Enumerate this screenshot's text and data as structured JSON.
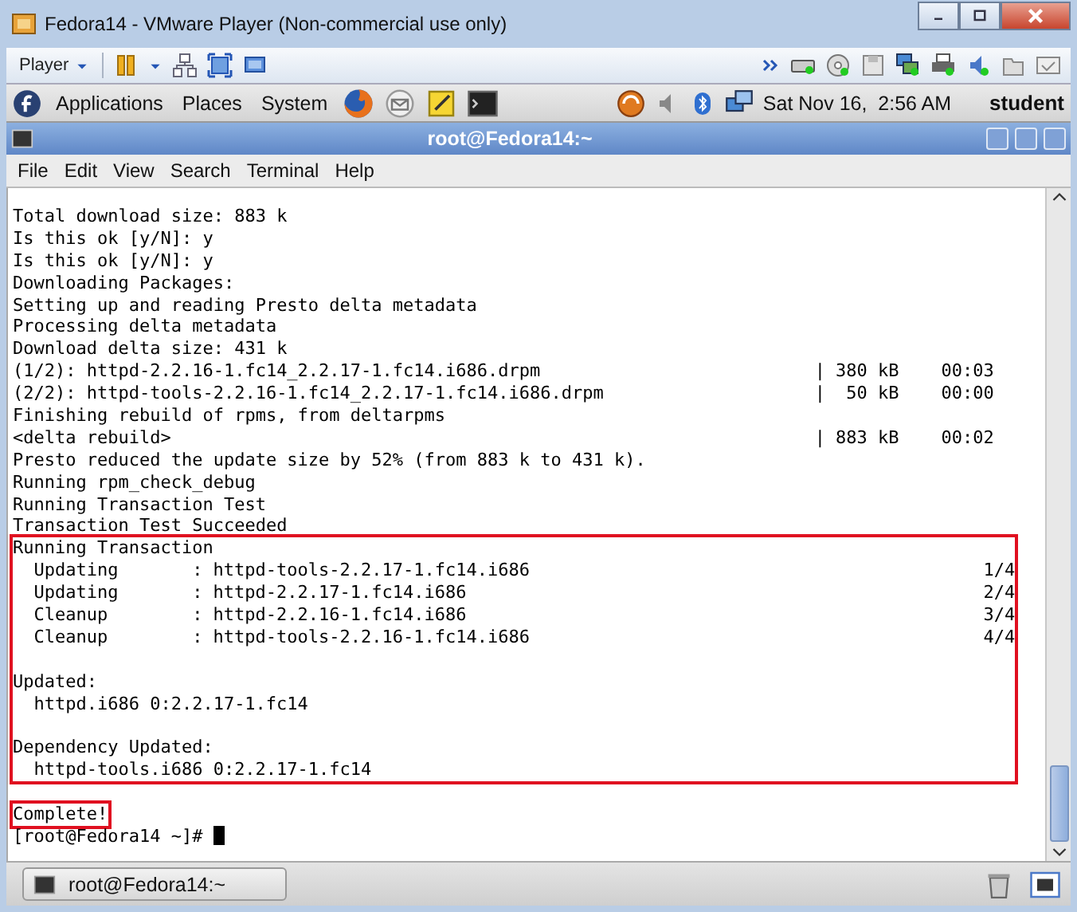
{
  "window": {
    "title": "Fedora14 - VMware Player (Non-commercial use only)"
  },
  "player_toolbar": {
    "menu": "Player"
  },
  "panel": {
    "menus": [
      "Applications",
      "Places",
      "System"
    ],
    "clock": "Sat Nov 16,  2:56 AM",
    "user": "student"
  },
  "terminal": {
    "title": "root@Fedora14:~",
    "menu": [
      "File",
      "Edit",
      "View",
      "Search",
      "Terminal",
      "Help"
    ],
    "blocks": [
      {
        "highlighted": false,
        "lines": [
          {
            "kind": "plain",
            "text": "Total download size: 883 k"
          },
          {
            "kind": "plain",
            "text": "Is this ok [y/N]: y"
          },
          {
            "kind": "plain",
            "text": "Is this ok [y/N]: y"
          },
          {
            "kind": "plain",
            "text": "Downloading Packages:"
          },
          {
            "kind": "plain",
            "text": "Setting up and reading Presto delta metadata"
          },
          {
            "kind": "plain",
            "text": "Processing delta metadata"
          },
          {
            "kind": "plain",
            "text": "Download delta size: 431 k"
          },
          {
            "kind": "download",
            "text": "(1/2): httpd-2.2.16-1.fc14_2.2.17-1.fc14.i686.drpm",
            "size": "| 380 kB",
            "time": "00:03"
          },
          {
            "kind": "download",
            "text": "(2/2): httpd-tools-2.2.16-1.fc14_2.2.17-1.fc14.i686.drpm",
            "size": "|  50 kB",
            "time": "00:00"
          },
          {
            "kind": "plain",
            "text": "Finishing rebuild of rpms, from deltarpms"
          },
          {
            "kind": "download",
            "text": "<delta rebuild>",
            "size": "| 883 kB",
            "time": "00:02"
          },
          {
            "kind": "plain",
            "text": "Presto reduced the update size by 52% (from 883 k to 431 k)."
          },
          {
            "kind": "plain",
            "text": "Running rpm_check_debug"
          },
          {
            "kind": "plain",
            "text": "Running Transaction Test"
          },
          {
            "kind": "plain",
            "text": "Transaction Test Succeeded"
          }
        ]
      },
      {
        "highlighted": true,
        "lines": [
          {
            "kind": "plain",
            "text": "Running Transaction"
          },
          {
            "kind": "step",
            "action": "Updating",
            "package": ": httpd-tools-2.2.17-1.fc14.i686",
            "progress": "1/4"
          },
          {
            "kind": "step",
            "action": "Updating",
            "package": ": httpd-2.2.17-1.fc14.i686",
            "progress": "2/4"
          },
          {
            "kind": "step",
            "action": "Cleanup",
            "package": ": httpd-2.2.16-1.fc14.i686",
            "progress": "3/4"
          },
          {
            "kind": "step",
            "action": "Cleanup",
            "package": ": httpd-tools-2.2.16-1.fc14.i686",
            "progress": "4/4"
          },
          {
            "kind": "blank"
          },
          {
            "kind": "plain",
            "text": "Updated:"
          },
          {
            "kind": "indented",
            "text": "httpd.i686 0:2.2.17-1.fc14"
          },
          {
            "kind": "blank"
          },
          {
            "kind": "plain",
            "text": "Dependency Updated:"
          },
          {
            "kind": "indented",
            "text": "httpd-tools.i686 0:2.2.17-1.fc14"
          }
        ]
      },
      {
        "highlighted": false,
        "lines": [
          {
            "kind": "blank"
          }
        ]
      },
      {
        "highlighted": true,
        "lines": [
          {
            "kind": "plain",
            "text": "Complete!"
          }
        ]
      }
    ],
    "prompt": "[root@Fedora14 ~]#"
  },
  "taskbar": {
    "items": [
      {
        "label": "root@Fedora14:~"
      }
    ]
  }
}
